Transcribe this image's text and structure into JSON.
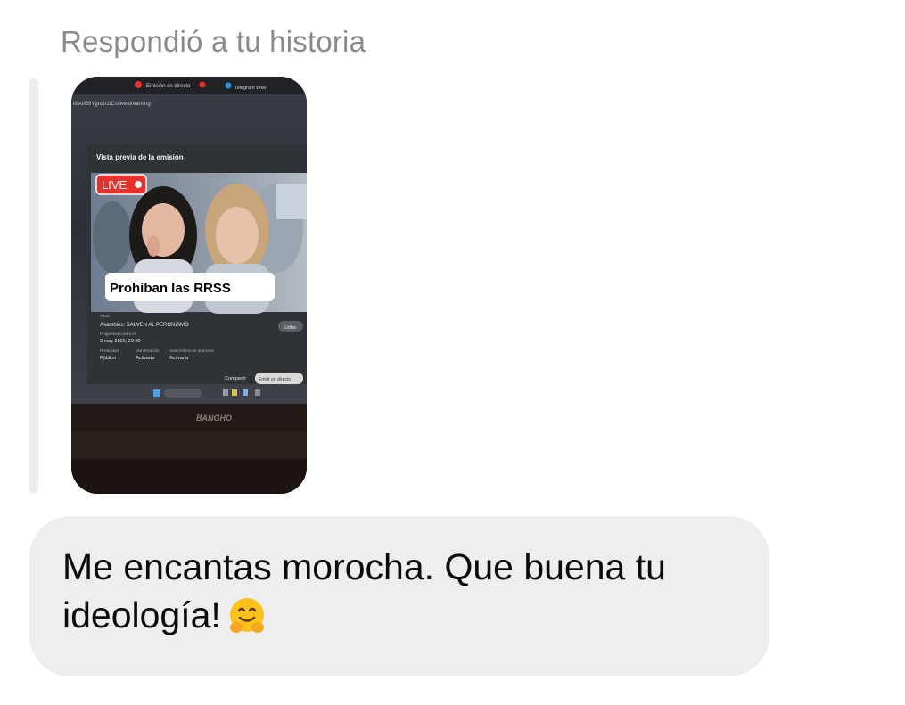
{
  "reply": {
    "header": "Respondió a tu historia"
  },
  "story": {
    "browser_tabs": [
      "Emisión en directo -",
      "Telegram Web"
    ],
    "url_text": "ideo/B9Ygnzh1tCs/livestreaming",
    "preview_title": "Vista previa de la emisión",
    "live_badge": "LIVE",
    "caption": "Prohíban las RRSS",
    "overlay_text": "",
    "field_title_label": "Título",
    "field_title_value": "Asambles: SALVEN AL PERONISMO",
    "field_schedule_label": "Programado para el",
    "field_schedule_value": "3 may 2026, 23:30",
    "field_privacy_label": "Privacidad",
    "field_privacy_value": "Público",
    "field_monet_label": "Monetización",
    "field_monet_value": "Activada",
    "field_auto_label": "Autorrelleno de anuncios",
    "field_auto_value": "Activada",
    "edit_button": "Editar",
    "share_button": "Compartir",
    "go_live_button": "Emitir en directo",
    "laptop_brand": "BANGHO"
  },
  "message": {
    "text": "Me encantas morocha. Que buena tu ideología!",
    "emoji": "hugging-face-icon"
  },
  "colors": {
    "bubble": "#eeeef1",
    "header_text": "#8a8a8e",
    "reply_bar": "#ececf0",
    "live_red": "#e5322d"
  }
}
